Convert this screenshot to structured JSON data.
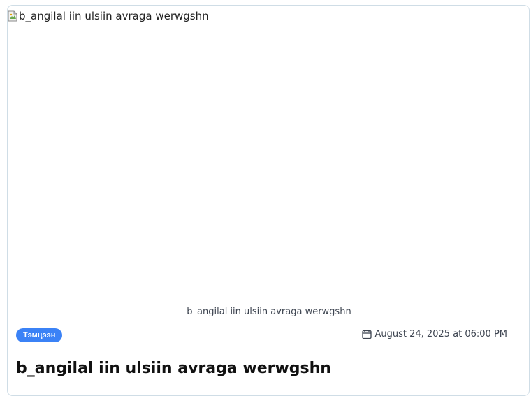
{
  "post": {
    "image_alt": "b_angilal iin ulsiin avraga werwgshn",
    "caption": "b_angilal iin ulsiin avraga werwgshn",
    "category": "Тэмцээн",
    "date": "August 24, 2025 at 06:00 PM",
    "title": "b_angilal iin ulsiin avraga werwgshn"
  },
  "icons": {
    "image": "broken-image-icon",
    "date": "calendar-icon"
  },
  "colors": {
    "badge": "#3b82f6",
    "card_border": "#cfdde6",
    "text_muted": "#3d4450"
  }
}
